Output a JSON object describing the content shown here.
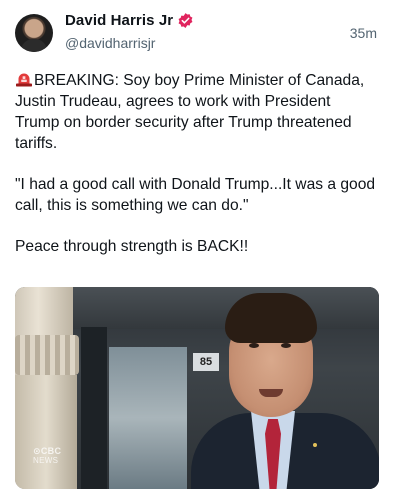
{
  "author": {
    "display_name": "David Harris Jr",
    "handle": "@davidharrisjr",
    "verified": true
  },
  "post": {
    "timestamp": "35m",
    "paragraphs": [
      "BREAKING: Soy boy Prime Minister of Canada, Justin Trudeau, agrees to work with President Trump on border security after Trump threatened tariffs.",
      "\"I had a good call with Donald Trump...It was a good call, this is something we can do.\"",
      "Peace through strength is BACK!!"
    ],
    "leading_icon": "rotating-light-icon"
  },
  "media": {
    "sign_text": "85",
    "watermark_main": "⊙CBC",
    "watermark_sub": "NEWS"
  },
  "colors": {
    "text": "#0f1419",
    "secondary": "#536471",
    "verified": "#e0245e"
  }
}
